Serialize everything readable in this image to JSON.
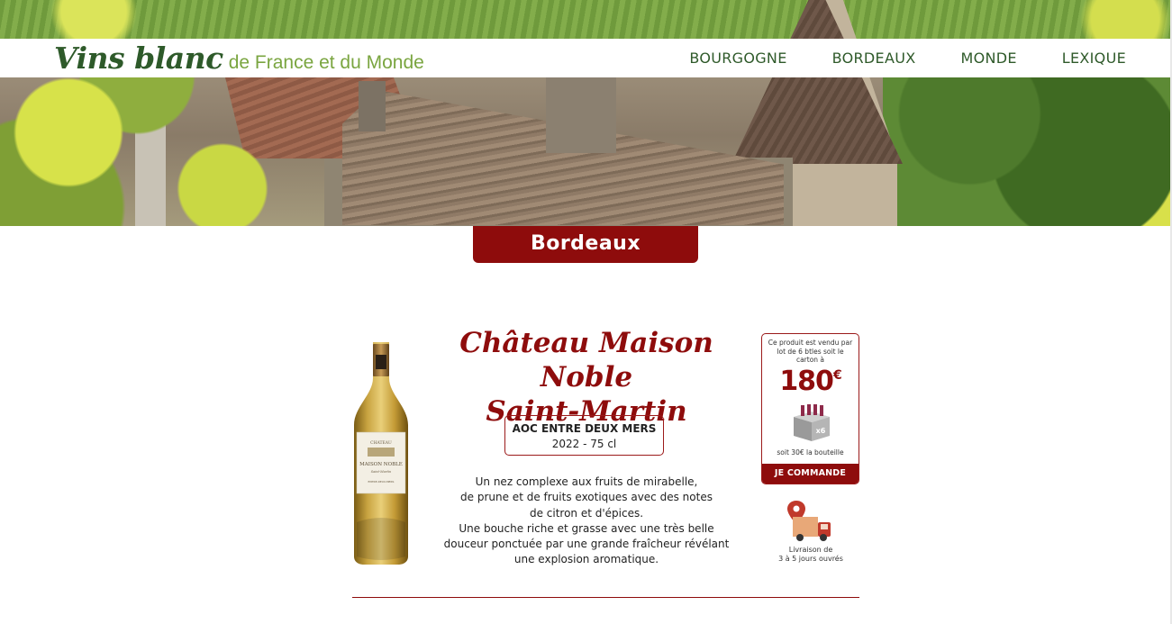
{
  "site": {
    "logo_main": "Vins blanc",
    "logo_sub": "de France et du Monde"
  },
  "nav": {
    "items": [
      {
        "label": "BOURGOGNE"
      },
      {
        "label": "BORDEAUX"
      },
      {
        "label": "MONDE"
      },
      {
        "label": "LEXIQUE"
      }
    ]
  },
  "region": {
    "label": "Bordeaux"
  },
  "product": {
    "name_line1": "Château Maison Noble",
    "name_line2": "Saint-Martin",
    "appellation": "AOC ENTRE DEUX MERS",
    "vintage_volume": "2022 - 75 cl",
    "description": [
      "Un nez complexe aux fruits de mirabelle,",
      "de prune et de fruits exotiques avec des notes",
      "de citron et d'épices.",
      "Une bouche riche et grasse avec une très belle",
      "douceur ponctuée par une grande fraîcheur révélant",
      "une explosion aromatique."
    ],
    "bottle_label": {
      "line1": "CHATEAU",
      "line2": "MAISON NOBLE",
      "line3": "Saint-Martin",
      "line4": "ENTRE-DEUX-MERS"
    }
  },
  "pricing": {
    "intro": "Ce produit est vendu par lot de 6 btles soit le carton à",
    "price": "180",
    "currency": "€",
    "carton_count": "x6",
    "per_bottle": "soit 30€ la bouteille",
    "order_label": "JE COMMANDE"
  },
  "delivery": {
    "line1": "Livraison de",
    "line2": "3 à 5 jours ouvrés"
  },
  "colors": {
    "accent": "#8e0c0c",
    "brand_green": "#2e5a2a",
    "brand_light_green": "#7aa540"
  }
}
